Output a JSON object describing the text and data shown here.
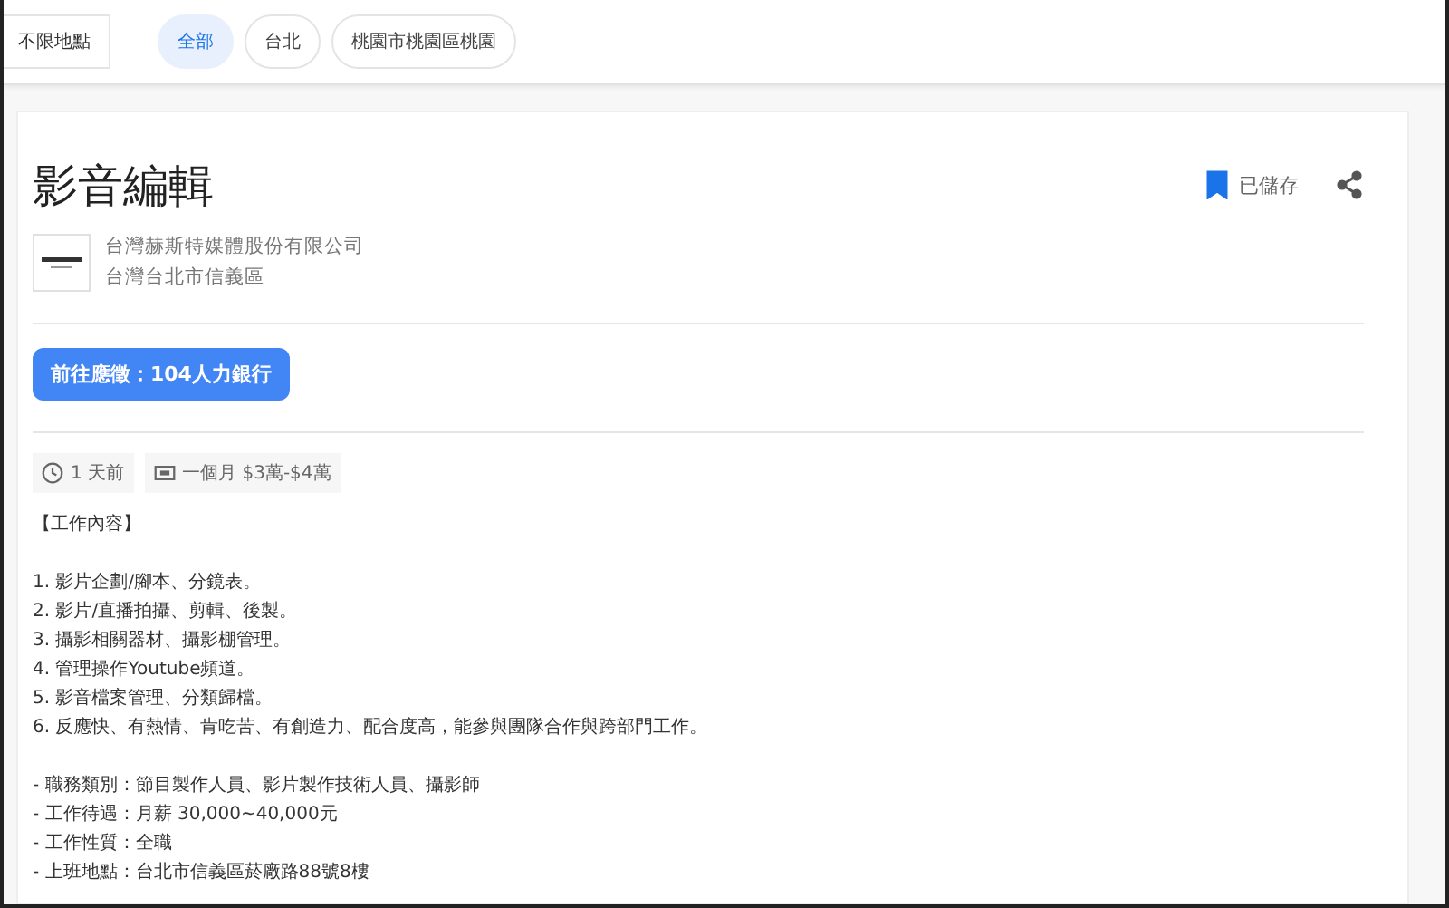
{
  "filters": {
    "location": "不限地點",
    "chips": [
      {
        "label": "全部",
        "selected": true
      },
      {
        "label": "台北",
        "selected": false
      },
      {
        "label": "桃園市桃園區桃園",
        "selected": false
      }
    ]
  },
  "job": {
    "title": "影音編輯",
    "company": "台灣赫斯特媒體股份有限公司",
    "location": "台灣台北市信義區",
    "saved": true,
    "save_label": "已儲存",
    "apply_button": "前往應徵：104人力銀行",
    "meta": [
      {
        "kind": "time",
        "text": "1 天前"
      },
      {
        "kind": "salary",
        "text": "一個月 $3萬-$4萬"
      }
    ],
    "description": [
      {
        "kind": "heading",
        "text": "【工作內容】"
      },
      {
        "kind": "gap"
      },
      {
        "kind": "line",
        "text": "1. 影片企劃/腳本、分鏡表。"
      },
      {
        "kind": "line",
        "text": "2. 影片/直播拍攝、剪輯、後製。"
      },
      {
        "kind": "line",
        "text": "3. 攝影相關器材、攝影棚管理。"
      },
      {
        "kind": "line",
        "text": "4. 管理操作Youtube頻道。"
      },
      {
        "kind": "line",
        "text": "5. 影音檔案管理、分類歸檔。"
      },
      {
        "kind": "line",
        "text": "6. 反應快、有熱情、肯吃苦、有創造力、配合度高，能參與團隊合作與跨部門工作。"
      },
      {
        "kind": "gap"
      },
      {
        "kind": "line",
        "text": "- 職務類別：節目製作人員、影片製作技術人員、攝影師"
      },
      {
        "kind": "line",
        "text": "- 工作待遇：月薪 30,000~40,000元"
      },
      {
        "kind": "line",
        "text": "- 工作性質：全職"
      },
      {
        "kind": "line",
        "text": "- 上班地點：台北市信義區菸廠路88號8樓"
      }
    ]
  }
}
